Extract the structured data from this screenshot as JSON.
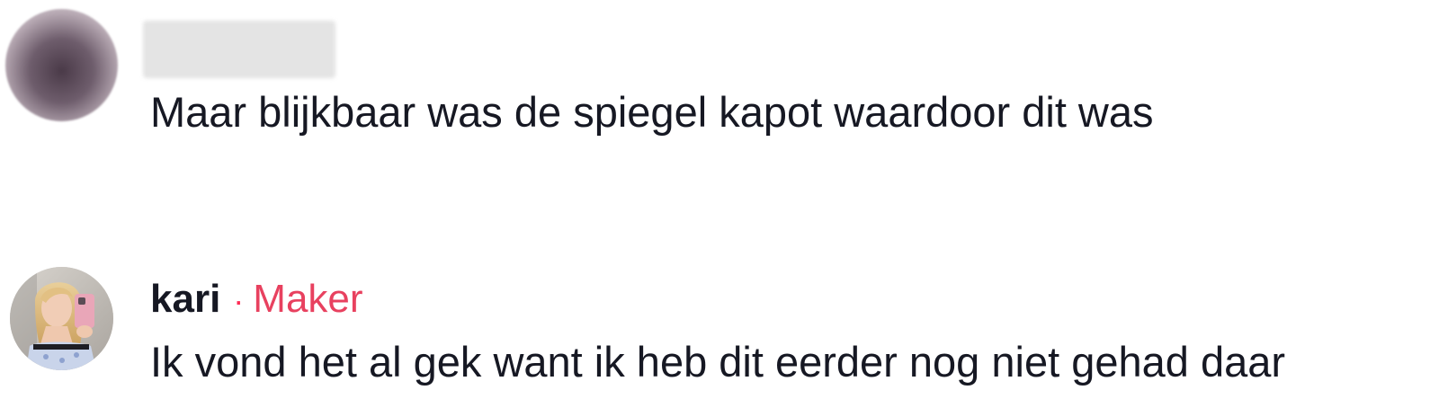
{
  "comments": [
    {
      "username": "",
      "username_blurred": true,
      "avatar": "blurred-avatar",
      "text": "Maar blijkbaar was de spiegel kapot waardoor dit was"
    },
    {
      "username": "kari",
      "separator": "·",
      "badge": "Maker",
      "badge_color": "#e8415f",
      "avatar": "profile-photo-avatar",
      "text": "Ik vond het al gek want ik heb dit eerder nog niet gehad daar"
    }
  ]
}
